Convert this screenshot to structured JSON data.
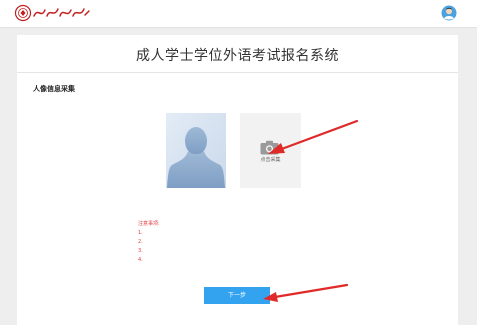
{
  "header": {
    "logo_icon": "university-seal-logo",
    "avatar_icon": "user-avatar"
  },
  "page": {
    "title": "成人学士学位外语考试报名系统",
    "section_label": "人像信息采集"
  },
  "photo_panel": {
    "placeholder_icon": "person-silhouette",
    "camera_icon": "camera-icon",
    "camera_label": "点击采集"
  },
  "notice": {
    "title": "注意事项:",
    "items": [
      {
        "num": "1.",
        "text": ""
      },
      {
        "num": "2.",
        "text": ""
      },
      {
        "num": "3.",
        "text": ""
      },
      {
        "num": "4.",
        "text": ""
      }
    ]
  },
  "actions": {
    "next_label": "下一步"
  },
  "colors": {
    "primary_button": "#33a3f0",
    "notice_text": "#e03b3b",
    "annotation_arrow": "#e02a2a"
  }
}
